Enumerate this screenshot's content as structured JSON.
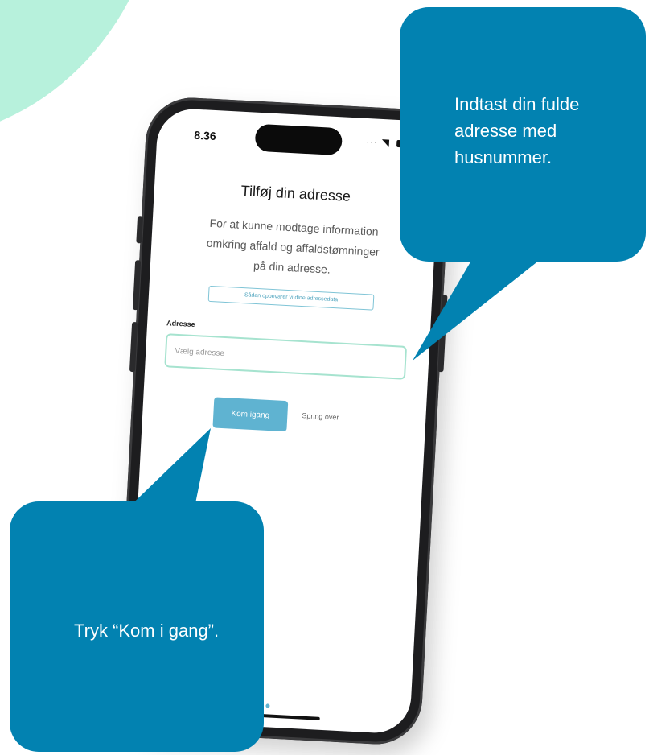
{
  "colors": {
    "callout_bg": "#0282b1",
    "accent": "#5fb3d1",
    "input_border": "#a6e3cf",
    "decor": "#b7f1dc"
  },
  "phone": {
    "status": {
      "time": "8.36",
      "icons": "... ▾"
    },
    "screen": {
      "title": "Tilføj din adresse",
      "description": "For at kunne modtage information\nomkring affald og affaldstømninger\npå din adresse.",
      "privacy_link": "Sådan opbevarer vi dine adressedata",
      "address_label": "Adresse",
      "address_value": "",
      "address_placeholder": "Vælg adresse",
      "start_button": "Kom igang",
      "skip_link": "Spring over"
    }
  },
  "callouts": {
    "top_right": "Indtast din fulde\nadresse med\nhusnummer.",
    "bottom_left": "Tryk “Kom i gang”."
  }
}
